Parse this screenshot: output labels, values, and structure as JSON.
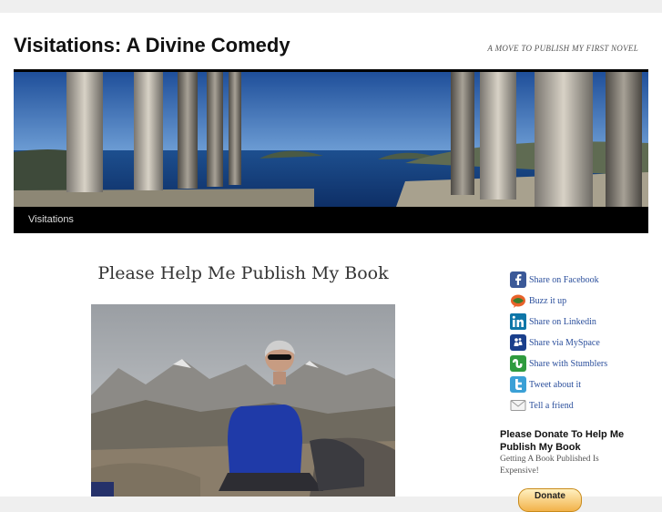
{
  "header": {
    "site_title": "Visitations: A Divine Comedy",
    "tagline": "A MOVE TO PUBLISH MY FIRST NOVEL"
  },
  "banner": {
    "image": "greek-temple-columns-sea-banner"
  },
  "nav": {
    "items": [
      {
        "label": "Visitations"
      }
    ]
  },
  "post": {
    "title": "Please Help Me Publish My Book",
    "image": "author-photo-mountains"
  },
  "share": {
    "items": [
      {
        "label": "Share on Facebook",
        "icon": "facebook-icon",
        "color": "#3b5998"
      },
      {
        "label": "Buzz it up",
        "icon": "buzz-icon",
        "color": "#e8622a"
      },
      {
        "label": "Share on Linkedin",
        "icon": "linkedin-icon",
        "color": "#0e76a8"
      },
      {
        "label": "Share via MySpace",
        "icon": "myspace-icon",
        "color": "#1a3f8c"
      },
      {
        "label": "Share with Stumblers",
        "icon": "stumbleupon-icon",
        "color": "#2f9b3f"
      },
      {
        "label": "Tweet about it",
        "icon": "twitter-icon",
        "color": "#3aa0d6"
      },
      {
        "label": "Tell a friend",
        "icon": "email-icon",
        "color": "#bbbbbb"
      }
    ]
  },
  "sidebar": {
    "donate_heading": "Please Donate To Help Me Publish My Book",
    "donate_text": "Getting A Book Published Is Expensive!",
    "donate_button": "Donate"
  }
}
